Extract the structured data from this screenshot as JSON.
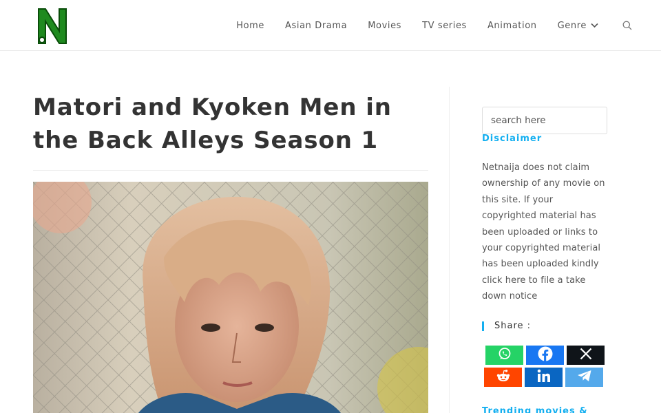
{
  "site": {
    "logo_letter": "N"
  },
  "nav": {
    "items": [
      {
        "label": "Home"
      },
      {
        "label": "Asian Drama"
      },
      {
        "label": "Movies"
      },
      {
        "label": "TV series"
      },
      {
        "label": "Animation"
      },
      {
        "label": "Genre",
        "has_dropdown": true
      }
    ],
    "search_icon": "search-icon"
  },
  "post": {
    "title": "Matori and Kyoken Men in the Back Alleys Season 1"
  },
  "sidebar": {
    "search_placeholder": "search here",
    "disclaimer_title": "Disclaimer",
    "disclaimer_text": "Netnaija does not claim ownership of any movie on this site. If your copyrighted material has been uploaded or links to your copyrighted material has been uploaded kindly click here to file a take down notice",
    "share_title": "Share :",
    "share_buttons": [
      {
        "name": "whatsapp",
        "color": "#25d366",
        "icon": "whatsapp-icon"
      },
      {
        "name": "facebook",
        "color": "#1877f2",
        "icon": "facebook-icon"
      },
      {
        "name": "x",
        "color": "#0f1419",
        "icon": "x-icon"
      },
      {
        "name": "reddit",
        "color": "#ff4500",
        "icon": "reddit-icon"
      },
      {
        "name": "linkedin",
        "color": "#0a66c2",
        "icon": "linkedin-icon"
      },
      {
        "name": "telegram",
        "color": "#54a9eb",
        "icon": "telegram-icon"
      }
    ],
    "trending_title": "Trending movies &"
  },
  "colors": {
    "accent": "#13aff0",
    "logo_green": "#1f8a1f"
  }
}
